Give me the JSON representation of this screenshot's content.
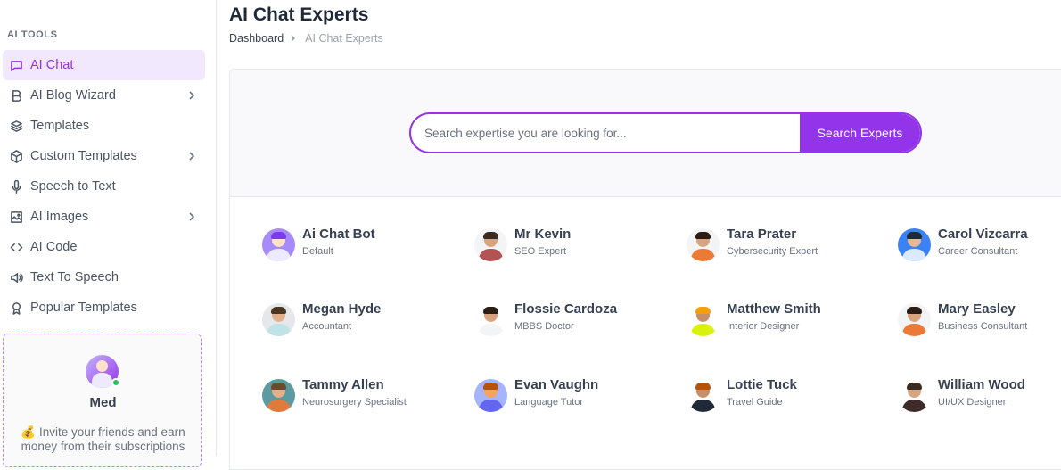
{
  "sidebar": {
    "section_label": "AI TOOLS",
    "items": [
      {
        "label": "AI Chat",
        "icon": "chat-icon",
        "active": true,
        "has_submenu": false
      },
      {
        "label": "AI Blog Wizard",
        "icon": "bold-b-icon",
        "active": false,
        "has_submenu": true
      },
      {
        "label": "Templates",
        "icon": "layers-icon",
        "active": false,
        "has_submenu": false
      },
      {
        "label": "Custom Templates",
        "icon": "cube-icon",
        "active": false,
        "has_submenu": true
      },
      {
        "label": "Speech to Text",
        "icon": "microphone-icon",
        "active": false,
        "has_submenu": false
      },
      {
        "label": "AI Images",
        "icon": "image-icon",
        "active": false,
        "has_submenu": true
      },
      {
        "label": "AI Code",
        "icon": "code-icon",
        "active": false,
        "has_submenu": false
      },
      {
        "label": "Text To Speech",
        "icon": "speaker-icon",
        "active": false,
        "has_submenu": false
      },
      {
        "label": "Popular Templates",
        "icon": "award-icon",
        "active": false,
        "has_submenu": false
      }
    ],
    "invite": {
      "name": "Med",
      "text": "💰 Invite your friends and earn money from their subscriptions"
    }
  },
  "header": {
    "title": "AI Chat Experts",
    "breadcrumb": {
      "home": "Dashboard",
      "current": "AI Chat Experts"
    }
  },
  "search": {
    "placeholder": "Search expertise you are looking for...",
    "value": "",
    "button_label": "Search Experts"
  },
  "experts": [
    {
      "name": "Ai Chat Bot",
      "role": "Default",
      "avatar_bg": "#a78bfa",
      "skin": "#fde2c8",
      "hair": "#7c3aed",
      "shirt": "#ede9fe"
    },
    {
      "name": "Mr Kevin",
      "role": "SEO Expert",
      "avatar_bg": "#f3f4f6",
      "skin": "#d8a47f",
      "hair": "#3b2a20",
      "shirt": "#b45353"
    },
    {
      "name": "Tara Prater",
      "role": "Cybersecurity Expert",
      "avatar_bg": "#f3f4f6",
      "skin": "#d8a47f",
      "hair": "#2b1d14",
      "shirt": "#ea7a35"
    },
    {
      "name": "Carol Vizcarra",
      "role": "Career Consultant",
      "avatar_bg": "#3b82f6",
      "skin": "#e6b894",
      "hair": "#1f2937",
      "shirt": "#dbeafe"
    },
    {
      "name": "Megan Hyde",
      "role": "Accountant",
      "avatar_bg": "#e5e7eb",
      "skin": "#e3b08c",
      "hair": "#4b3621",
      "shirt": "#bfe3e6"
    },
    {
      "name": "Flossie Cardoza",
      "role": "MBBS Doctor",
      "avatar_bg": "#ffffff",
      "skin": "#d8a47f",
      "hair": "#2b1d14",
      "shirt": "#f3f4f6"
    },
    {
      "name": "Matthew Smith",
      "role": "Interior Designer",
      "avatar_bg": "#ffffff",
      "skin": "#c98f69",
      "hair": "#f59e0b",
      "shirt": "#d9f20b"
    },
    {
      "name": "Mary Easley",
      "role": "Business Consultant",
      "avatar_bg": "#f3f4f6",
      "skin": "#d8a47f",
      "hair": "#2b1d14",
      "shirt": "#ea7a35"
    },
    {
      "name": "Tammy Allen",
      "role": "Neurosurgery Specialist",
      "avatar_bg": "#5b9aa0",
      "skin": "#e3b08c",
      "hair": "#6b4b2a",
      "shirt": "#e07a3f"
    },
    {
      "name": "Evan Vaughn",
      "role": "Language Tutor",
      "avatar_bg": "#a5b4fc",
      "skin": "#f4a460",
      "hair": "#b45309",
      "shirt": "#6366f1"
    },
    {
      "name": "Lottie Tuck",
      "role": "Travel Guide",
      "avatar_bg": "#ffffff",
      "skin": "#c98f69",
      "hair": "#b45309",
      "shirt": "#1f2937"
    },
    {
      "name": "William Wood",
      "role": "UI/UX Designer",
      "avatar_bg": "#ffffff",
      "skin": "#d8a47f",
      "hair": "#3b2a20",
      "shirt": "#3f2a2a"
    }
  ],
  "colors": {
    "accent": "#9333ea",
    "active_bg": "#f1e8fd",
    "online": "#22c55e"
  }
}
